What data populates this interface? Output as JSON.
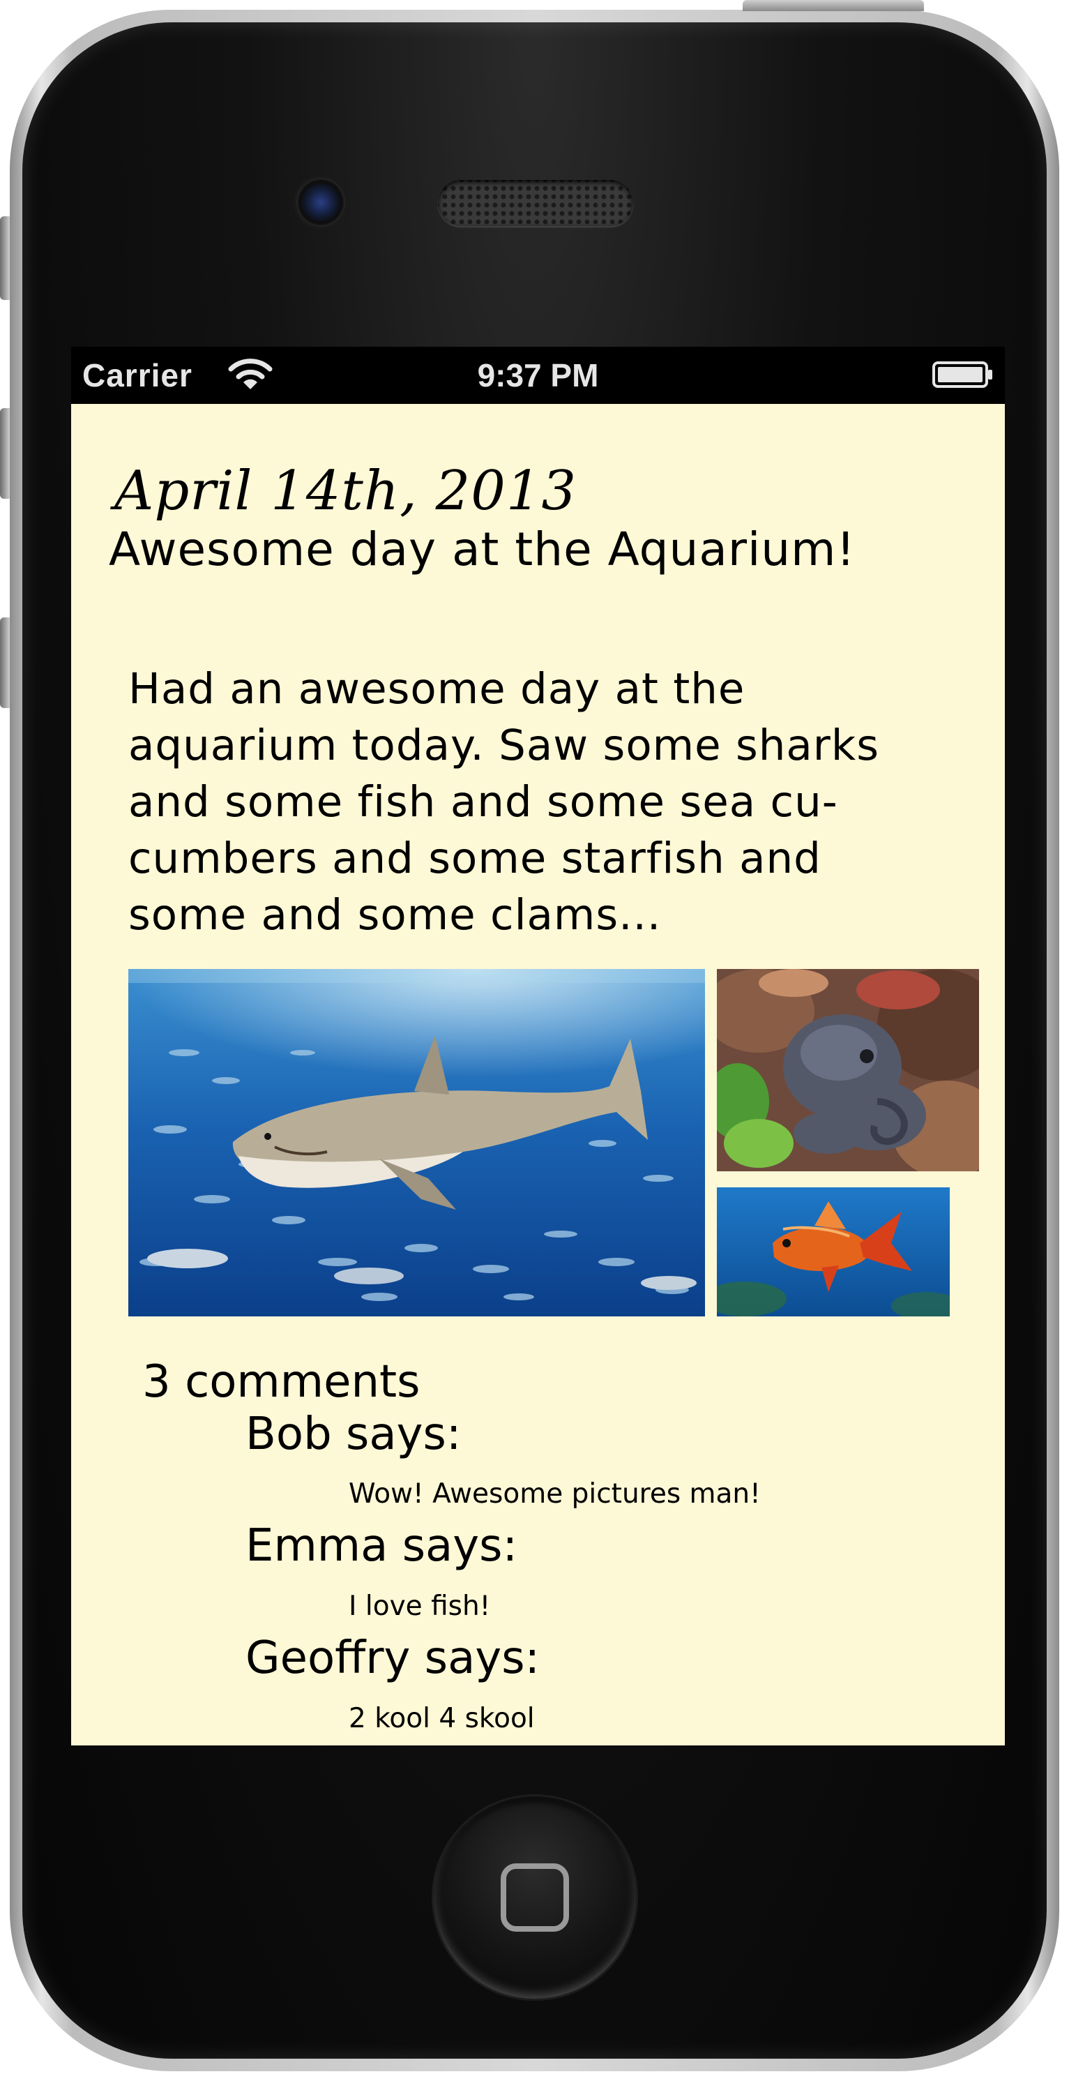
{
  "status_bar": {
    "carrier": "Carrier",
    "time": "9:37 PM",
    "wifi_icon": "wifi-icon",
    "battery_icon": "battery-icon"
  },
  "post": {
    "date": "April 14th, 2013",
    "title": "Awesome day at the Aquarium!",
    "body_lines": [
      "Had an awesome day at the",
      "aquarium today. Saw some sharks",
      "and some fish and some sea cu-",
      "cumbers and some starfish and",
      "some and some clams..."
    ],
    "photos": [
      "shark-photo",
      "octopus-photo",
      "goldfish-photo"
    ]
  },
  "comments": {
    "count_label": "3 comments",
    "items": [
      {
        "author_label": "Bob says:",
        "text": "Wow! Awesome pictures man!"
      },
      {
        "author_label": "Emma says:",
        "text": "I love fish!"
      },
      {
        "author_label": "Geoffry says:",
        "text": "2 kool 4 skool"
      }
    ]
  },
  "colors": {
    "screen_background": "#fdf8d6",
    "status_bar_background": "#000000",
    "phone_bezel": "#0a0a0a"
  }
}
